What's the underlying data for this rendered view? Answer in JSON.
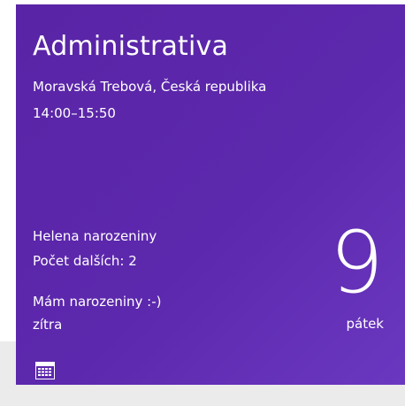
{
  "tile": {
    "app_icon": "calendar-icon",
    "background_color": "#5c28ad",
    "event": {
      "title": "Administrativa",
      "location": "Moravská Trebová, Česká republika",
      "time": "14:00–15:50"
    },
    "birthday": {
      "name": "Helena narozeniny",
      "more": "Počet dalších: 2"
    },
    "reminder": {
      "text": "Mám narozeniny :-)",
      "when": "zítra"
    },
    "date": {
      "day_number": "9",
      "day_name": "pátek"
    }
  }
}
